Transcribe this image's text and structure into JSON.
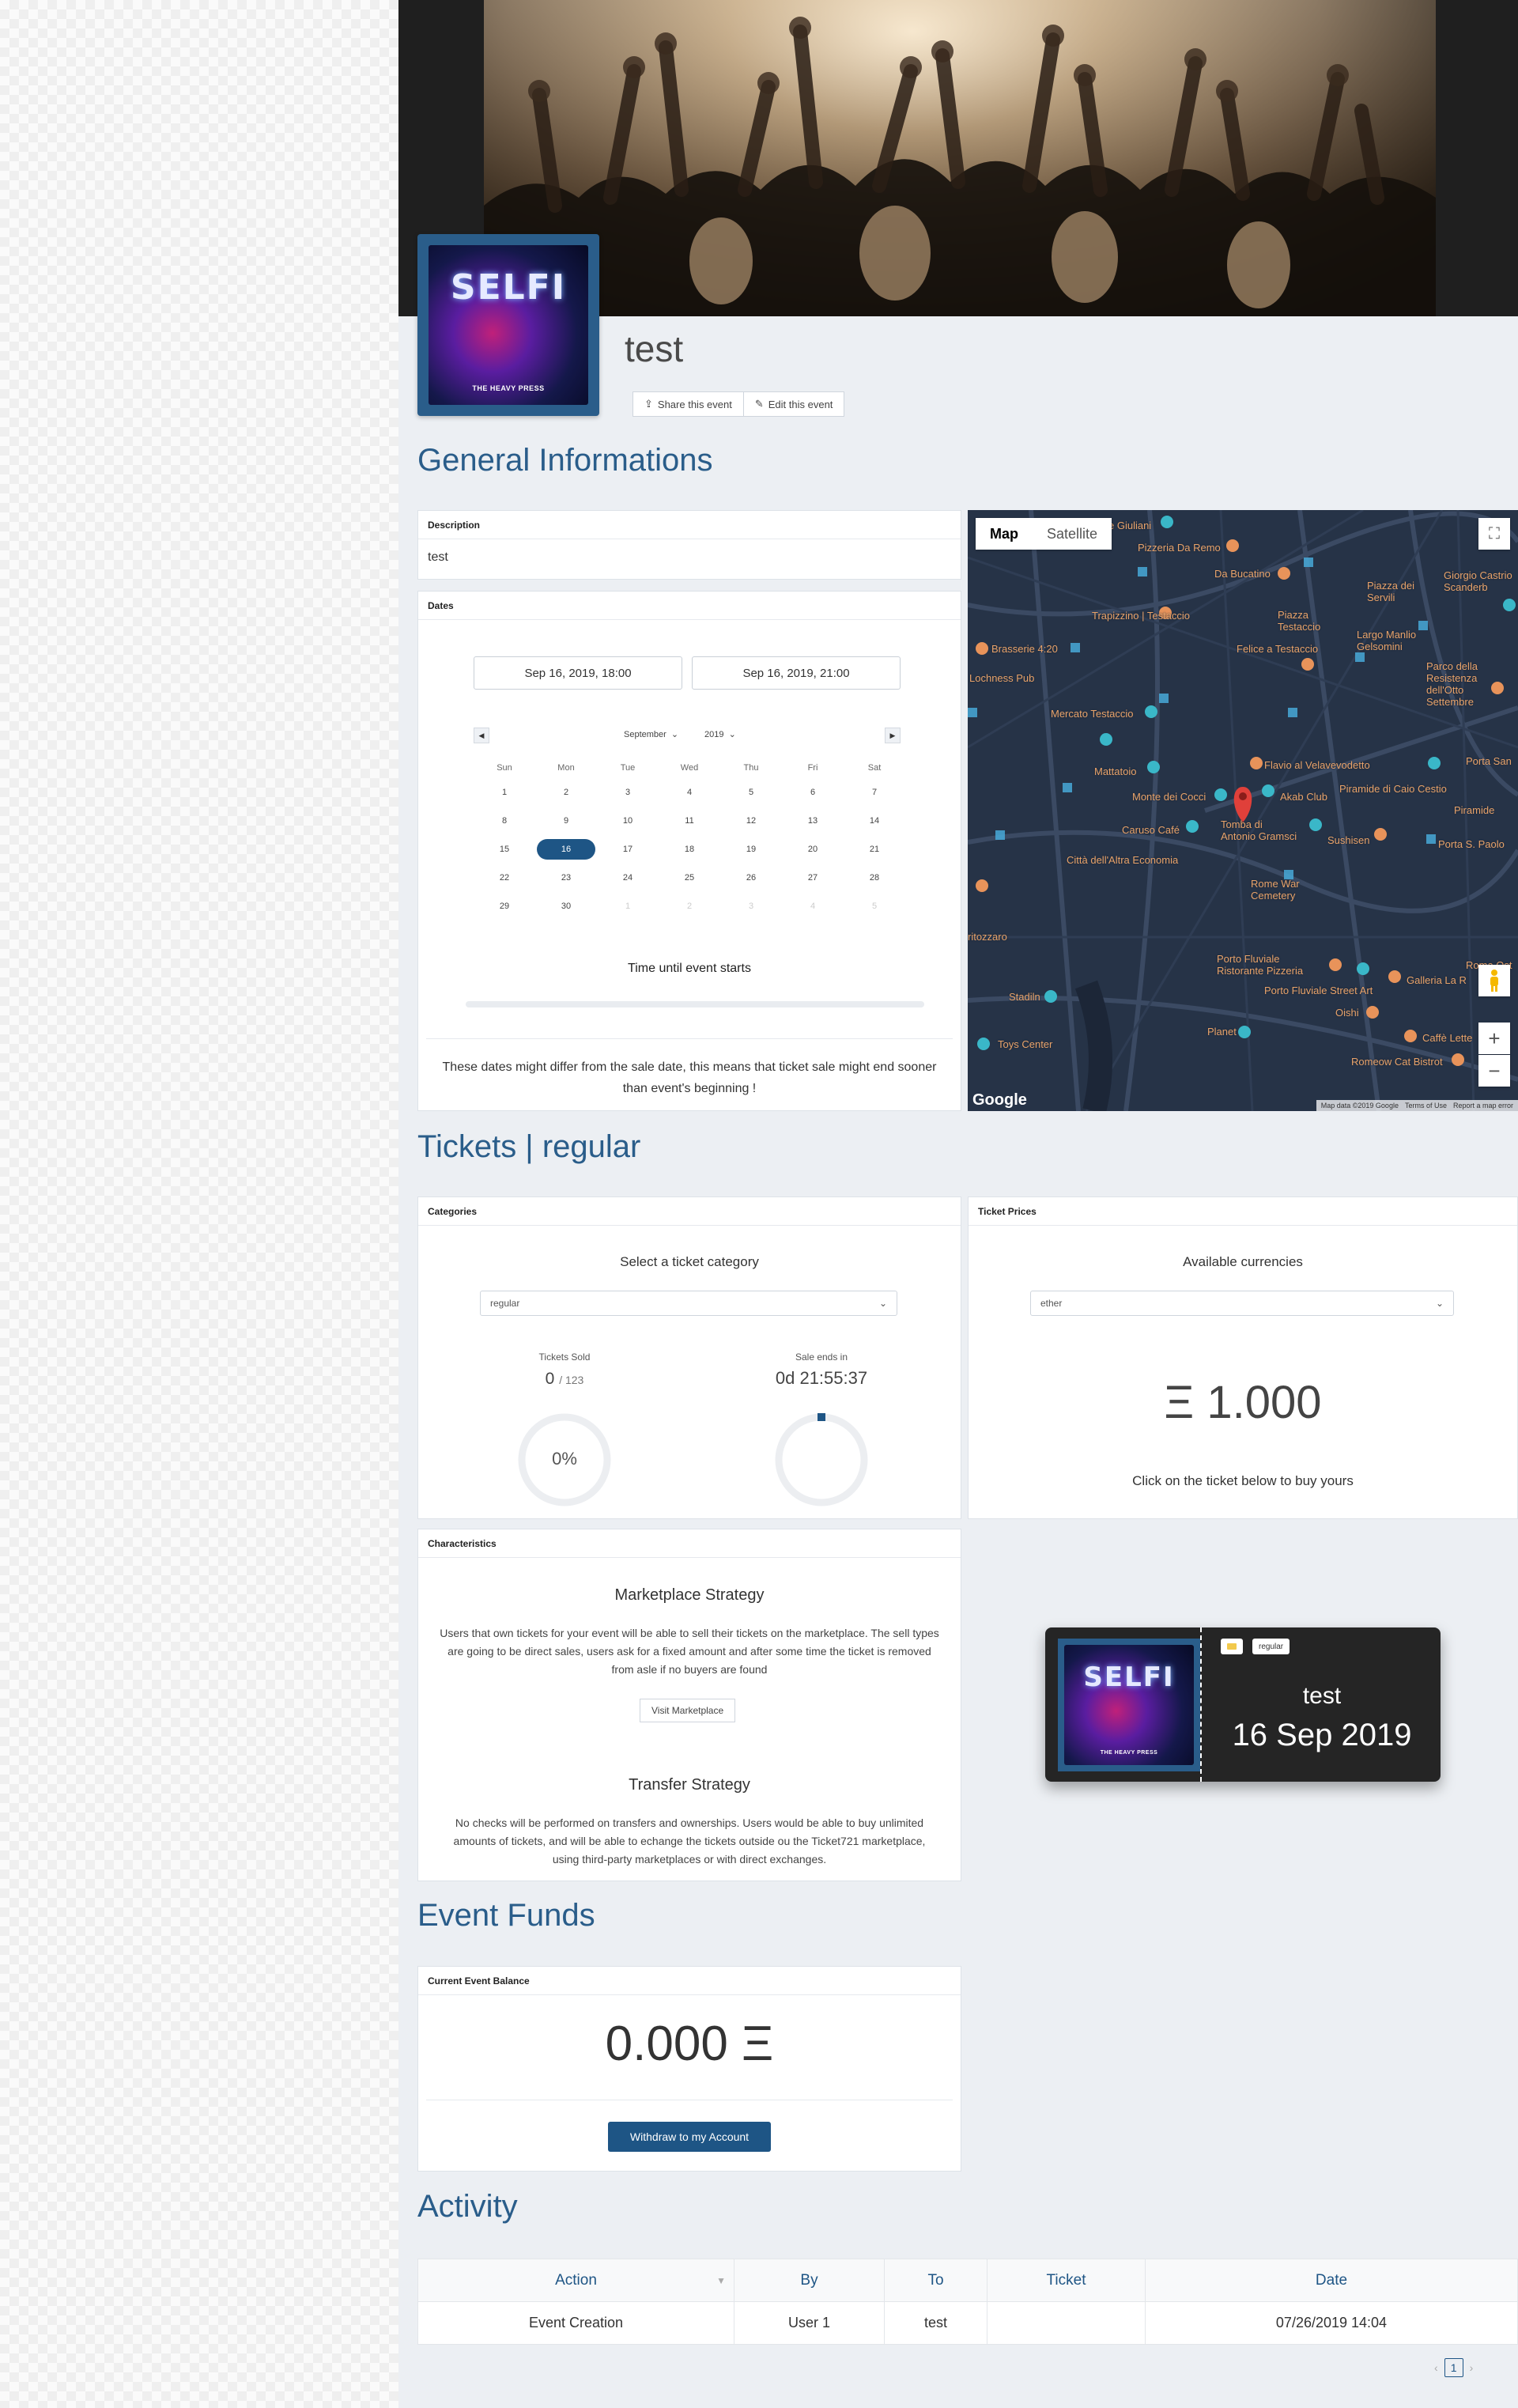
{
  "event": {
    "title": "test",
    "share_label": "Share this event",
    "edit_label": "Edit this event",
    "poster_title": "SELFI",
    "poster_subtitle": "THE HEAVY PRESS"
  },
  "general": {
    "section_title": "General Informations",
    "description_header": "Description",
    "description_text": "test",
    "dates_header": "Dates",
    "start_date": "Sep 16, 2019, 18:00",
    "end_date": "Sep 16, 2019, 21:00",
    "calendar": {
      "month": "September",
      "year": "2019",
      "weekdays": [
        "Sun",
        "Mon",
        "Tue",
        "Wed",
        "Thu",
        "Fri",
        "Sat"
      ],
      "days": [
        [
          "1",
          "2",
          "3",
          "4",
          "5",
          "6",
          "7"
        ],
        [
          "8",
          "9",
          "10",
          "11",
          "12",
          "13",
          "14"
        ],
        [
          "15",
          "16",
          "17",
          "18",
          "19",
          "20",
          "21"
        ],
        [
          "22",
          "23",
          "24",
          "25",
          "26",
          "27",
          "28"
        ],
        [
          "29",
          "30",
          "1",
          "2",
          "3",
          "4",
          "5"
        ]
      ],
      "selected_day": "16"
    },
    "countdown_label": "Time until event starts",
    "note": "These dates might differ from the sale date, this means that ticket sale might end sooner than event's beginning !"
  },
  "map": {
    "tab_map": "Map",
    "tab_satellite": "Satellite",
    "google": "Google",
    "footer_data": "Map data ©2019 Google",
    "footer_terms": "Terms of Use",
    "footer_report": "Report a map error",
    "places": [
      "Pizzeria Da Remo",
      "Da Bucatino",
      "Piazza Testaccio",
      "Trapizzino | Testaccio",
      "Brasserie 4:20",
      "Lochness Pub",
      "Felice a Testaccio",
      "Largo Manlio Gelsomini",
      "Piazza dei Servili",
      "Giorgio Castrie Scanderb",
      "Parco della Resistenza dell'Otto Settembre",
      "Mercato Testaccio",
      "Mattatoio",
      "Flavio al Velavevodetto",
      "Piramide di Caio Cestio",
      "Porta San",
      "Monte dei Cocci",
      "Akab Club",
      "Caruso Café",
      "Tomba di Antonio Gramsci",
      "Sushisen",
      "Piramide",
      "Porta S. Paolo",
      "Città dell'Altra Economia",
      "Rome War Cemetery",
      "Porto Fluviale Ristorante Pizzeria",
      "Porto Fluviale Street Art",
      "Galleria La R",
      "Roma Ost",
      "Stadiln",
      "Oishi",
      "Toys Center",
      "Planet",
      "Caffè Lette",
      "Romeow Cat Bistrot",
      "ritozzaro",
      "Giuliani"
    ]
  },
  "tickets": {
    "section_title": "Tickets | regular",
    "categories_header": "Categories",
    "select_label": "Select a ticket category",
    "category_value": "regular",
    "sold_label": "Tickets Sold",
    "sold_count": "0",
    "sold_total": "/ 123",
    "sold_percent": "0%",
    "sold_fraction": 0,
    "sale_ends_label": "Sale ends in",
    "sale_ends_value": "0d 21:55:37",
    "prices_header": "Ticket Prices",
    "currencies_label": "Available currencies",
    "currency_value": "ether",
    "price": "Ξ 1.000",
    "buy_hint": "Click on the ticket below to buy yours",
    "characteristics_header": "Characteristics",
    "marketplace_title": "Marketplace Strategy",
    "marketplace_text": "Users that own tickets for your event will be able to sell their tickets on the marketplace. The sell types are going to be direct sales, users ask for a fixed amount and after some time the ticket is removed from asle if no buyers are found",
    "marketplace_button": "Visit Marketplace",
    "transfer_title": "Transfer Strategy",
    "transfer_text": "No checks will be performed on transfers and ownerships. Users would be able to buy unlimited amounts of tickets, and will be able to echange the tickets outside ou the Ticket721 marketplace, using third-party marketplaces or with direct exchanges.",
    "ticket_badge": "regular",
    "ticket_title": "test",
    "ticket_date": "16 Sep 2019"
  },
  "funds": {
    "section_title": "Event Funds",
    "balance_header": "Current Event Balance",
    "balance": "0.000 Ξ",
    "withdraw_label": "Withdraw to my Account"
  },
  "activity": {
    "section_title": "Activity",
    "columns": [
      "Action",
      "By",
      "To",
      "Ticket",
      "Date"
    ],
    "rows": [
      [
        "Event Creation",
        "User 1",
        "test",
        "",
        "07/26/2019 14:04"
      ]
    ],
    "page": "1"
  },
  "colors": {
    "accent": "#1e5585",
    "title_blue": "#2a5d8a",
    "map_bg": "#263347",
    "poi_orange": "#e8935a",
    "poi_teal": "#3ab7c8"
  }
}
